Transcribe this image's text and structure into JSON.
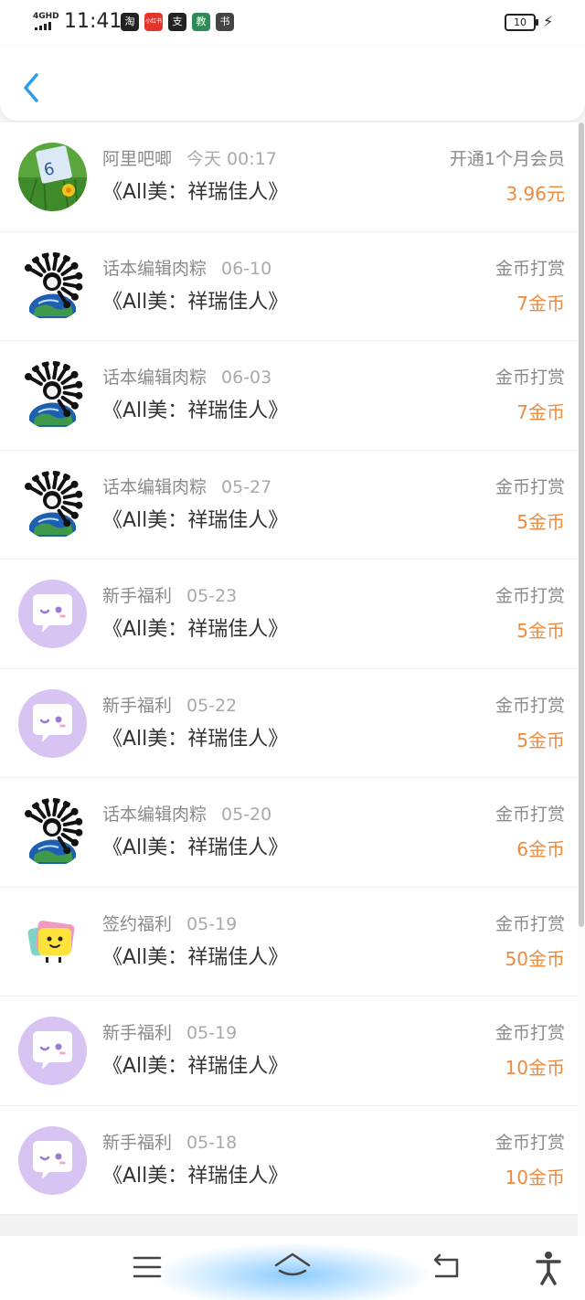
{
  "status_bar": {
    "network": "4GHD",
    "time": "11:41",
    "battery": "10",
    "apps": [
      {
        "label": "淘",
        "color": "#222222"
      },
      {
        "label": "小红书",
        "color": "#e5352b"
      },
      {
        "label": "支",
        "color": "#222222"
      },
      {
        "label": "教",
        "color": "#2e8b57"
      },
      {
        "label": "书",
        "color": "#444444"
      }
    ]
  },
  "header": {
    "back_icon": "chevron-left-icon",
    "accent": "#2f9bea"
  },
  "records": [
    {
      "user": "阿里吧唧",
      "date": "今天 00:17",
      "title": "《All美：祥瑞佳人》",
      "type": "开通1个月会员",
      "amount": "3.96元",
      "avatar": "photo"
    },
    {
      "user": "话本编辑肉粽",
      "date": "06-10",
      "title": "《All美：祥瑞佳人》",
      "type": "金币打赏",
      "amount": "7金币",
      "avatar": "earth"
    },
    {
      "user": "话本编辑肉粽",
      "date": "06-03",
      "title": "《All美：祥瑞佳人》",
      "type": "金币打赏",
      "amount": "7金币",
      "avatar": "earth"
    },
    {
      "user": "话本编辑肉粽",
      "date": "05-27",
      "title": "《All美：祥瑞佳人》",
      "type": "金币打赏",
      "amount": "5金币",
      "avatar": "earth"
    },
    {
      "user": "新手福利",
      "date": "05-23",
      "title": "《All美：祥瑞佳人》",
      "type": "金币打赏",
      "amount": "5金币",
      "avatar": "bubble"
    },
    {
      "user": "新手福利",
      "date": "05-22",
      "title": "《All美：祥瑞佳人》",
      "type": "金币打赏",
      "amount": "5金币",
      "avatar": "bubble"
    },
    {
      "user": "话本编辑肉粽",
      "date": "05-20",
      "title": "《All美：祥瑞佳人》",
      "type": "金币打赏",
      "amount": "6金币",
      "avatar": "earth"
    },
    {
      "user": "签约福利",
      "date": "05-19",
      "title": "《All美：祥瑞佳人》",
      "type": "金币打赏",
      "amount": "50金币",
      "avatar": "yellow"
    },
    {
      "user": "新手福利",
      "date": "05-19",
      "title": "《All美：祥瑞佳人》",
      "type": "金币打赏",
      "amount": "10金币",
      "avatar": "bubble"
    },
    {
      "user": "新手福利",
      "date": "05-18",
      "title": "《All美：祥瑞佳人》",
      "type": "金币打赏",
      "amount": "10金币",
      "avatar": "bubble"
    }
  ],
  "colors": {
    "amount": "#ef8a3c",
    "bubble_avatar": "#d8c4f2"
  },
  "nav": [
    "menu-icon",
    "home-icon",
    "back-icon",
    "accessibility-icon"
  ]
}
